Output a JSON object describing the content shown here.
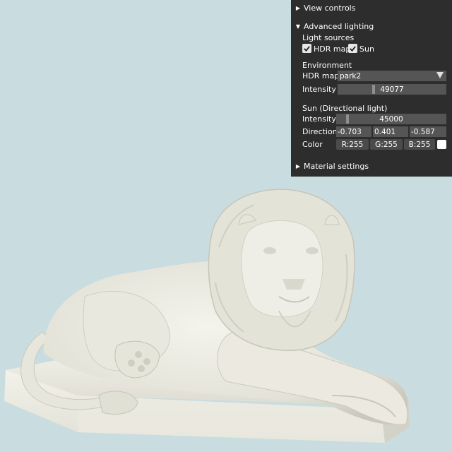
{
  "panel": {
    "view_controls": "View controls",
    "advanced_lighting": "Advanced lighting",
    "light_sources": "Light sources",
    "hdr_map_checkbox": "HDR map",
    "hdr_map_checked": true,
    "sun_checkbox": "Sun",
    "sun_checked": true,
    "environment": "Environment",
    "hdr_map_label": "HDR map",
    "hdr_map_value": "park2",
    "env_intensity_label": "Intensity",
    "env_intensity_value": "49077",
    "env_intensity_fraction": 0.325,
    "sun_header": "Sun (Directional light)",
    "sun_intensity_label": "Intensity",
    "sun_intensity_value": "45000",
    "sun_intensity_fraction": 0.09,
    "direction_label": "Direction",
    "direction": [
      "-0.703",
      "0.401",
      "-0.587"
    ],
    "color_label": "Color",
    "color_r": "R:255",
    "color_g": "G:255",
    "color_b": "B:255",
    "sun_color": "#ffffff",
    "material_settings": "Material settings"
  },
  "colors": {
    "background": "#c9dde0",
    "panel": "#2d2d2d",
    "field": "#555555",
    "statue": "#ecebe2"
  }
}
